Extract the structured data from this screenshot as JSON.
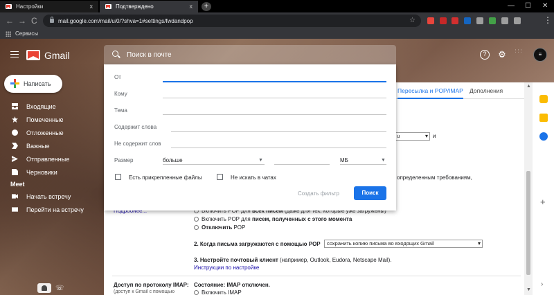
{
  "browser": {
    "tabs": [
      {
        "title": "Настройки",
        "close": "x"
      },
      {
        "title": "Подтверждено",
        "close": "x"
      }
    ],
    "new_tab": "+",
    "window_controls": {
      "minimize": "—",
      "maximize": "☐",
      "close": "✕"
    },
    "nav": {
      "back": "←",
      "forward": "→",
      "reload": "C"
    },
    "url": "mail.google.com/mail/u/0/?shva=1#settings/fwdandpop",
    "bookmarks": {
      "label": "Сервисы"
    },
    "extension_colors": [
      "#e8453c",
      "#c62828",
      "#d32f2f",
      "#1565c0",
      "#9e9e9e",
      "#43a047",
      "#9e9e9e",
      "#9e9e9e"
    ]
  },
  "gmail": {
    "brand": "Gmail",
    "header_icons": {
      "help": "?",
      "settings": "⚙",
      "apps": "⋮⋮⋮"
    },
    "avatar": "≡"
  },
  "compose": {
    "label": "Написать"
  },
  "nav": {
    "items": [
      {
        "label": "Входящие",
        "icon": "inbox-icon"
      },
      {
        "label": "Помеченные",
        "icon": "star-icon"
      },
      {
        "label": "Отложенные",
        "icon": "clock-icon"
      },
      {
        "label": "Важные",
        "icon": "important-icon"
      },
      {
        "label": "Отправленные",
        "icon": "send-icon"
      },
      {
        "label": "Черновики",
        "icon": "draft-icon"
      }
    ],
    "meet": {
      "heading": "Meet",
      "items": [
        {
          "label": "Начать встречу",
          "icon": "video-icon"
        },
        {
          "label": "Перейти на встречу",
          "icon": "keyboard-icon"
        }
      ]
    }
  },
  "search": {
    "placeholder": "Поиск в почте",
    "advanced": {
      "fields": [
        {
          "label": "От",
          "value": ""
        },
        {
          "label": "Кому",
          "value": ""
        },
        {
          "label": "Тема",
          "value": ""
        },
        {
          "label": "Содержит слова",
          "value": ""
        },
        {
          "label": "Не содержит слов",
          "value": ""
        }
      ],
      "size": {
        "label": "Размер",
        "operator": "больше",
        "value": "",
        "unit": "МБ"
      },
      "checkboxes": [
        {
          "label": "Есть прикрепленные файлы",
          "checked": false
        },
        {
          "label": "Не искать в чатах",
          "checked": false
        }
      ],
      "create_filter": "Создать фильтр",
      "search_button": "Поиск"
    }
  },
  "settings": {
    "tabs": [
      {
        "label": "Пересылка и POP/IMAP",
        "active": true
      },
      {
        "label": "Дополнения",
        "active": false
      }
    ],
    "partial_select_value": "u",
    "partial_text_right": "и",
    "partial_line": "определенным требованиям,",
    "more_link": "Подробнее...",
    "pop": {
      "options": [
        {
          "pre": "Включить POP для ",
          "bold": "всех писем",
          "post": " (даже для тех, которые уже загружены)"
        },
        {
          "pre": "Включить POP для ",
          "bold": "писем, полученных с этого момента",
          "post": ""
        },
        {
          "pre": "",
          "bold": "Отключить",
          "post": " POP"
        }
      ],
      "step2_label": "2. Когда письма загружаются с помощью POP",
      "step2_select": "сохранить копию письма во входящих Gmail",
      "step3_bold": "3. Настройте почтовый клиент",
      "step3_rest": " (например, Outlook, Eudora, Netscape Mail).",
      "setup_link": "Инструкции по настройке"
    },
    "imap": {
      "label": "Доступ по протоколу IMAP:",
      "sublabel": "(доступ к Gmail с помощью",
      "status": "Состояние: IMAP отключен.",
      "option": "Включить IMAP"
    }
  }
}
